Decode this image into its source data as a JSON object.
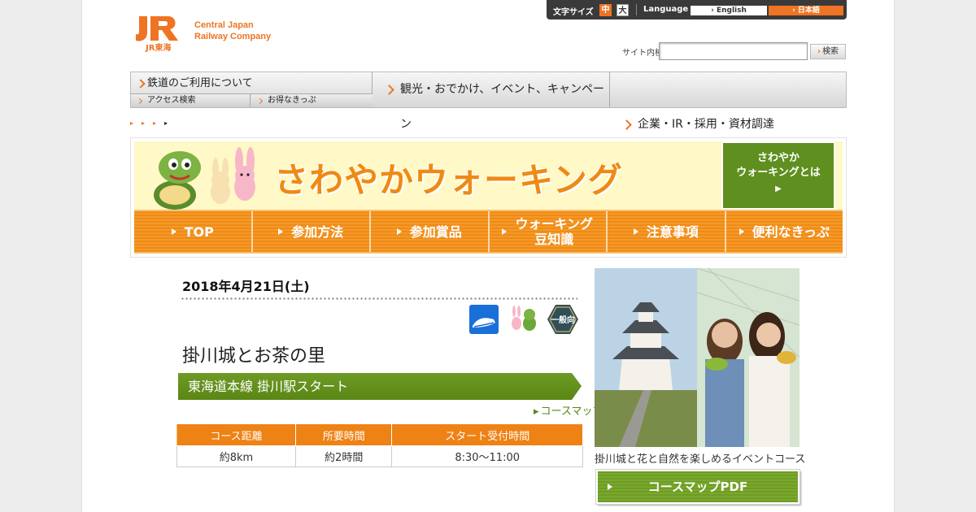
{
  "header": {
    "logo_mark": "JR東海",
    "logo_tag_line1": "Central Japan",
    "logo_tag_line2": "Railway Company",
    "font_size_label": "文字サイズ",
    "font_size_mid": "中",
    "font_size_large": "大",
    "language_label": "Language",
    "lang_english": "English",
    "lang_japanese": "日本語",
    "search_label": "サイト内検索",
    "search_button": "検索"
  },
  "gnav": {
    "rail": "鉄道のご利用について",
    "rail_sub1": "アクセス検索",
    "rail_sub2": "お得なきっぷ",
    "sightseeing": "観光・おでかけ、イベント、キャンペーン",
    "corporate": "企業・IR・採用・資材調達"
  },
  "banner": {
    "title": "さわやかウォーキング",
    "about_line1": "さわやか",
    "about_line2": "ウォーキングとは",
    "menu": [
      {
        "label": "TOP"
      },
      {
        "label": "参加方法"
      },
      {
        "label": "参加賞品"
      },
      {
        "label": "ウォーキング\n豆知識"
      },
      {
        "label": "注意事項"
      },
      {
        "label": "便利なきっぷ"
      }
    ]
  },
  "event": {
    "date": "2018年4月21日(土)",
    "general_badge": "一般向",
    "title": "掛川城とお茶の里",
    "course": "東海道本線 掛川駅スタート",
    "course_link": "コースマップ",
    "table_headers": [
      "コース距離",
      "所要時間",
      "スタート受付時間"
    ],
    "table_values": [
      "約8km",
      "約2時間",
      "8:30～11:00"
    ]
  },
  "side": {
    "caption": "掛川城と花と自然を楽しめるイベントコース",
    "pdf_button": "コースマップPDF"
  },
  "colors": {
    "brand_orange": "#ee7424",
    "walking_green": "#5f8f1e",
    "banner_yellow": "#fff8c7"
  }
}
